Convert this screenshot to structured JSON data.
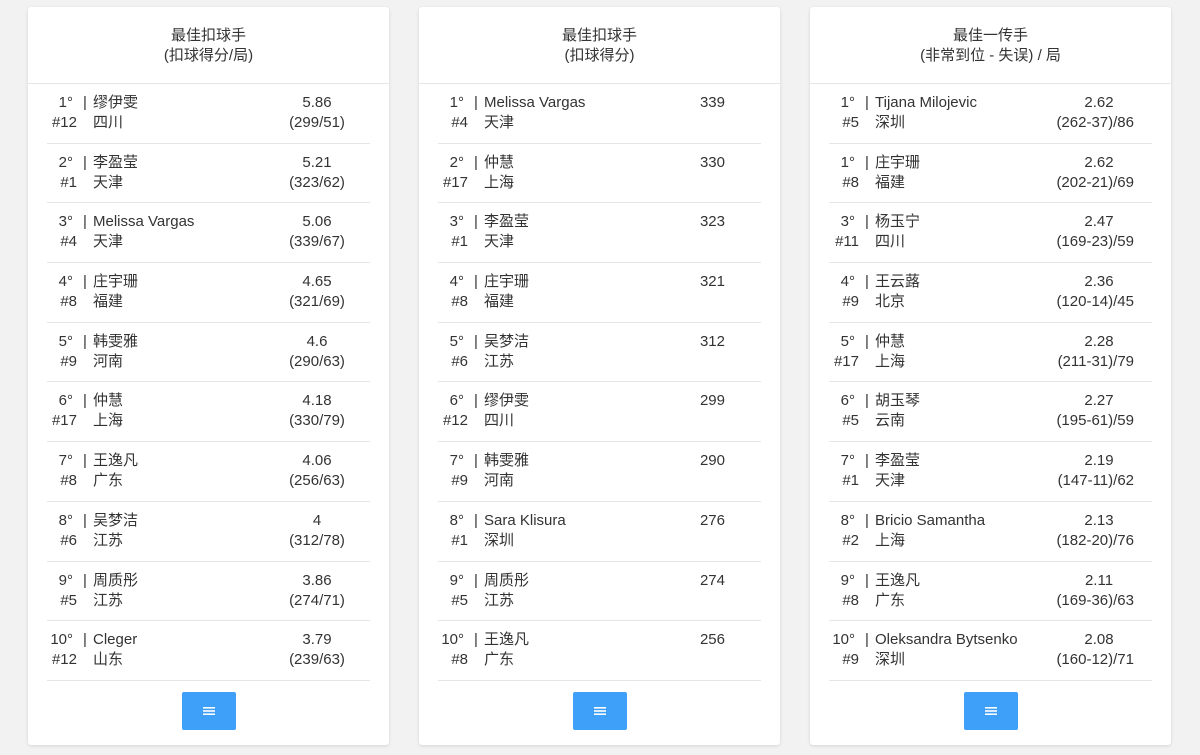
{
  "panels": [
    {
      "title_line1": "最佳扣球手",
      "title_line2": "(扣球得分/局)",
      "rows": [
        {
          "rank": "1°",
          "num": "#12",
          "name": "缪伊雯",
          "team": "四川",
          "value": "5.86",
          "sub": "(299/51)"
        },
        {
          "rank": "2°",
          "num": "#1",
          "name": "李盈莹",
          "team": "天津",
          "value": "5.21",
          "sub": "(323/62)"
        },
        {
          "rank": "3°",
          "num": "#4",
          "name": "Melissa Vargas",
          "team": "天津",
          "value": "5.06",
          "sub": "(339/67)"
        },
        {
          "rank": "4°",
          "num": "#8",
          "name": "庄宇珊",
          "team": "福建",
          "value": "4.65",
          "sub": "(321/69)"
        },
        {
          "rank": "5°",
          "num": "#9",
          "name": "韩雯雅",
          "team": "河南",
          "value": "4.6",
          "sub": "(290/63)"
        },
        {
          "rank": "6°",
          "num": "#17",
          "name": "仲慧",
          "team": "上海",
          "value": "4.18",
          "sub": "(330/79)"
        },
        {
          "rank": "7°",
          "num": "#8",
          "name": "王逸凡",
          "team": "广东",
          "value": "4.06",
          "sub": "(256/63)"
        },
        {
          "rank": "8°",
          "num": "#6",
          "name": "吴梦洁",
          "team": "江苏",
          "value": "4",
          "sub": "(312/78)"
        },
        {
          "rank": "9°",
          "num": "#5",
          "name": "周质彤",
          "team": "江苏",
          "value": "3.86",
          "sub": "(274/71)"
        },
        {
          "rank": "10°",
          "num": "#12",
          "name": "Cleger",
          "team": "山东",
          "value": "3.79",
          "sub": "(239/63)"
        }
      ]
    },
    {
      "title_line1": "最佳扣球手",
      "title_line2": "(扣球得分)",
      "rows": [
        {
          "rank": "1°",
          "num": "#4",
          "name": "Melissa Vargas",
          "team": "天津",
          "value": "339",
          "sub": ""
        },
        {
          "rank": "2°",
          "num": "#17",
          "name": "仲慧",
          "team": "上海",
          "value": "330",
          "sub": ""
        },
        {
          "rank": "3°",
          "num": "#1",
          "name": "李盈莹",
          "team": "天津",
          "value": "323",
          "sub": ""
        },
        {
          "rank": "4°",
          "num": "#8",
          "name": "庄宇珊",
          "team": "福建",
          "value": "321",
          "sub": ""
        },
        {
          "rank": "5°",
          "num": "#6",
          "name": "吴梦洁",
          "team": "江苏",
          "value": "312",
          "sub": ""
        },
        {
          "rank": "6°",
          "num": "#12",
          "name": "缪伊雯",
          "team": "四川",
          "value": "299",
          "sub": ""
        },
        {
          "rank": "7°",
          "num": "#9",
          "name": "韩雯雅",
          "team": "河南",
          "value": "290",
          "sub": ""
        },
        {
          "rank": "8°",
          "num": "#1",
          "name": "Sara Klisura",
          "team": "深圳",
          "value": "276",
          "sub": ""
        },
        {
          "rank": "9°",
          "num": "#5",
          "name": "周质彤",
          "team": "江苏",
          "value": "274",
          "sub": ""
        },
        {
          "rank": "10°",
          "num": "#8",
          "name": "王逸凡",
          "team": "广东",
          "value": "256",
          "sub": ""
        }
      ]
    },
    {
      "title_line1": "最佳一传手",
      "title_line2": "(非常到位 - 失误) / 局",
      "rows": [
        {
          "rank": "1°",
          "num": "#5",
          "name": "Tijana Milojevic",
          "team": "深圳",
          "value": "2.62",
          "sub": "(262-37)/86"
        },
        {
          "rank": "1°",
          "num": "#8",
          "name": "庄宇珊",
          "team": "福建",
          "value": "2.62",
          "sub": "(202-21)/69"
        },
        {
          "rank": "3°",
          "num": "#11",
          "name": "杨玉宁",
          "team": "四川",
          "value": "2.47",
          "sub": "(169-23)/59"
        },
        {
          "rank": "4°",
          "num": "#9",
          "name": "王云蕗",
          "team": "北京",
          "value": "2.36",
          "sub": "(120-14)/45"
        },
        {
          "rank": "5°",
          "num": "#17",
          "name": "仲慧",
          "team": "上海",
          "value": "2.28",
          "sub": "(211-31)/79"
        },
        {
          "rank": "6°",
          "num": "#5",
          "name": "胡玉琴",
          "team": "云南",
          "value": "2.27",
          "sub": "(195-61)/59"
        },
        {
          "rank": "7°",
          "num": "#1",
          "name": "李盈莹",
          "team": "天津",
          "value": "2.19",
          "sub": "(147-11)/62"
        },
        {
          "rank": "8°",
          "num": "#2",
          "name": "Bricio Samantha",
          "team": "上海",
          "value": "2.13",
          "sub": "(182-20)/76"
        },
        {
          "rank": "9°",
          "num": "#8",
          "name": "王逸凡",
          "team": "广东",
          "value": "2.11",
          "sub": "(169-36)/63"
        },
        {
          "rank": "10°",
          "num": "#9",
          "name": "Oleksandra Bytsenko",
          "team": "深圳",
          "value": "2.08",
          "sub": "(160-12)/71"
        }
      ]
    }
  ],
  "separator": "|",
  "more_button_icon": "list-icon",
  "colors": {
    "button": "#3ea0f8",
    "text": "#333333",
    "divider": "#e6e6e6",
    "background": "#f2f2f2"
  }
}
